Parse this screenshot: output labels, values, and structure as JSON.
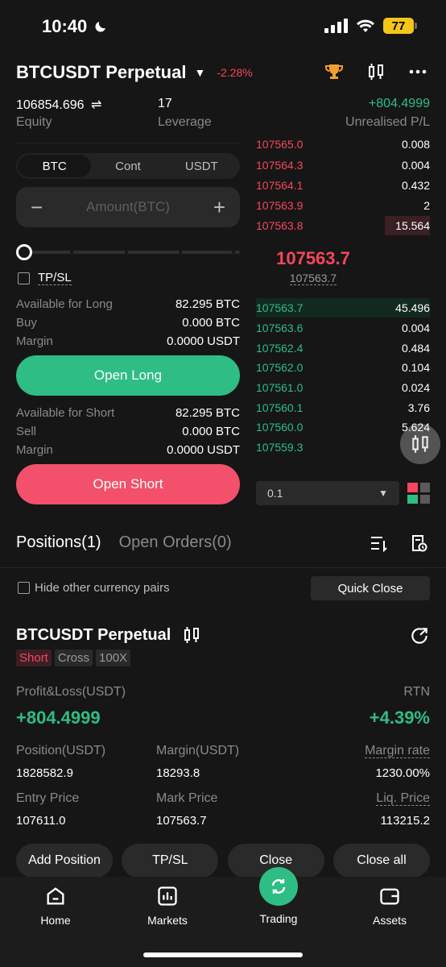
{
  "status": {
    "time": "10:40",
    "battery": "77"
  },
  "header": {
    "symbol": "BTCUSDT Perpetual",
    "change": "-2.28%",
    "equity_value": "106854.696",
    "equity_label": "Equity",
    "leverage_value": "17",
    "leverage_label": "Leverage",
    "upl_value": "+804.4999",
    "upl_label": "Unrealised P/L"
  },
  "form": {
    "units": [
      "BTC",
      "Cont",
      "USDT"
    ],
    "amount_placeholder": "Amount(BTC)",
    "tpsl_label": "TP/SL",
    "long": {
      "available_label": "Available for Long",
      "available_value": "82.295 BTC",
      "buy_label": "Buy",
      "buy_value": "0.000 BTC",
      "margin_label": "Margin",
      "margin_value": "0.0000 USDT",
      "button": "Open Long"
    },
    "short": {
      "available_label": "Available for Short",
      "available_value": "82.295 BTC",
      "sell_label": "Sell",
      "sell_value": "0.000 BTC",
      "margin_label": "Margin",
      "margin_value": "0.0000 USDT",
      "button": "Open Short"
    }
  },
  "orderbook": {
    "asks": [
      {
        "price": "107565.0",
        "qty": "0.008"
      },
      {
        "price": "107564.3",
        "qty": "0.004"
      },
      {
        "price": "107564.1",
        "qty": "0.432"
      },
      {
        "price": "107563.9",
        "qty": "2"
      },
      {
        "price": "107563.8",
        "qty": "15.564"
      }
    ],
    "last_price": "107563.7",
    "mark_price": "107563.7",
    "bids": [
      {
        "price": "107563.7",
        "qty": "45.496"
      },
      {
        "price": "107563.6",
        "qty": "0.004"
      },
      {
        "price": "107562.4",
        "qty": "0.484"
      },
      {
        "price": "107562.0",
        "qty": "0.104"
      },
      {
        "price": "107561.0",
        "qty": "0.024"
      },
      {
        "price": "107560.1",
        "qty": "3.76"
      },
      {
        "price": "107560.0",
        "qty": "5.624"
      },
      {
        "price": "107559.3",
        "qty": ""
      }
    ],
    "depth": "0.1"
  },
  "positions": {
    "tab_positions": "Positions(1)",
    "tab_orders": "Open Orders(0)",
    "hide_pairs": "Hide other currency pairs",
    "quick_close": "Quick Close",
    "symbol": "BTCUSDT Perpetual",
    "tags": [
      "Short",
      "Cross",
      "100X"
    ],
    "pl_label": "Profit&Loss(USDT)",
    "pl_value": "+804.4999",
    "rtn_label": "RTN",
    "rtn_value": "+4.39%",
    "position_label": "Position(USDT)",
    "position_value": "1828582.9",
    "margin_label": "Margin(USDT)",
    "margin_value": "18293.8",
    "margin_rate_label": "Margin rate",
    "margin_rate_value": "1230.00%",
    "entry_label": "Entry Price",
    "entry_value": "107611.0",
    "mark_label": "Mark Price",
    "mark_value": "107563.7",
    "liq_label": "Liq. Price",
    "liq_value": "113215.2",
    "actions": [
      "Add Position",
      "TP/SL",
      "Close",
      "Close all"
    ]
  },
  "nav": [
    "Home",
    "Markets",
    "Trading",
    "Assets"
  ],
  "colors": {
    "green": "#2ebd85",
    "red": "#f6465d",
    "orange": "#f0b90b"
  }
}
